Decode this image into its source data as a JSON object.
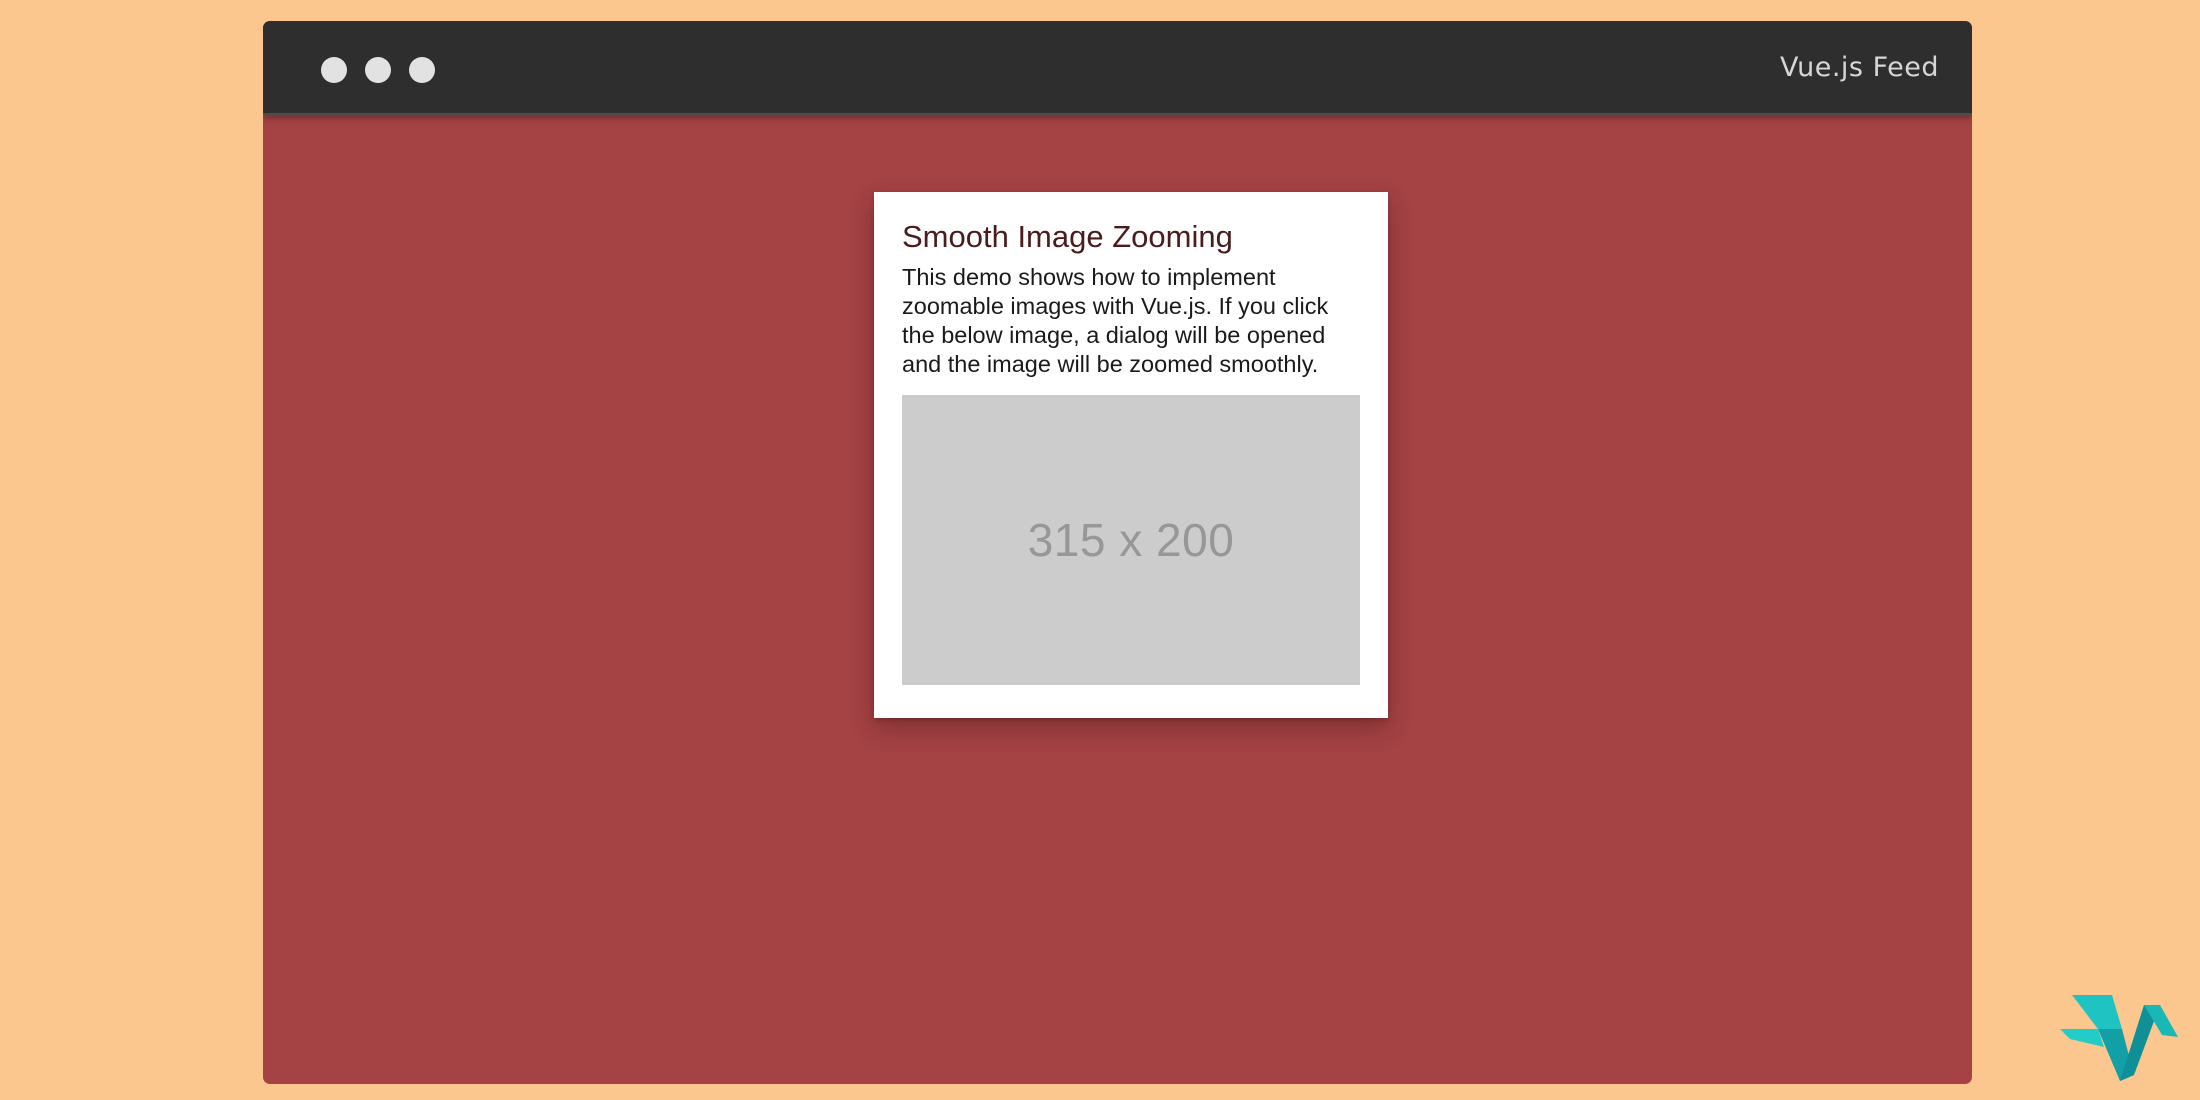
{
  "window": {
    "title": "Vue.js Feed"
  },
  "card": {
    "title": "Smooth Image Zooming",
    "description": "This demo shows how to implement zoomable images with Vue.js. If you click the below image, a dialog will be opened and the image will be zoomed smoothly.",
    "image_placeholder": "315 x 200"
  },
  "icons": {
    "window_controls": [
      "window-dot-icon",
      "window-dot-icon",
      "window-dot-icon"
    ],
    "logo": "vue-feed-logo-icon"
  },
  "colors": {
    "background": "#fbc78e",
    "window_body": "#a44244",
    "titlebar": "#2e2e2e",
    "card": "#ffffff",
    "placeholder": "#cccccc",
    "logo_teal": "#1ab7b7"
  }
}
